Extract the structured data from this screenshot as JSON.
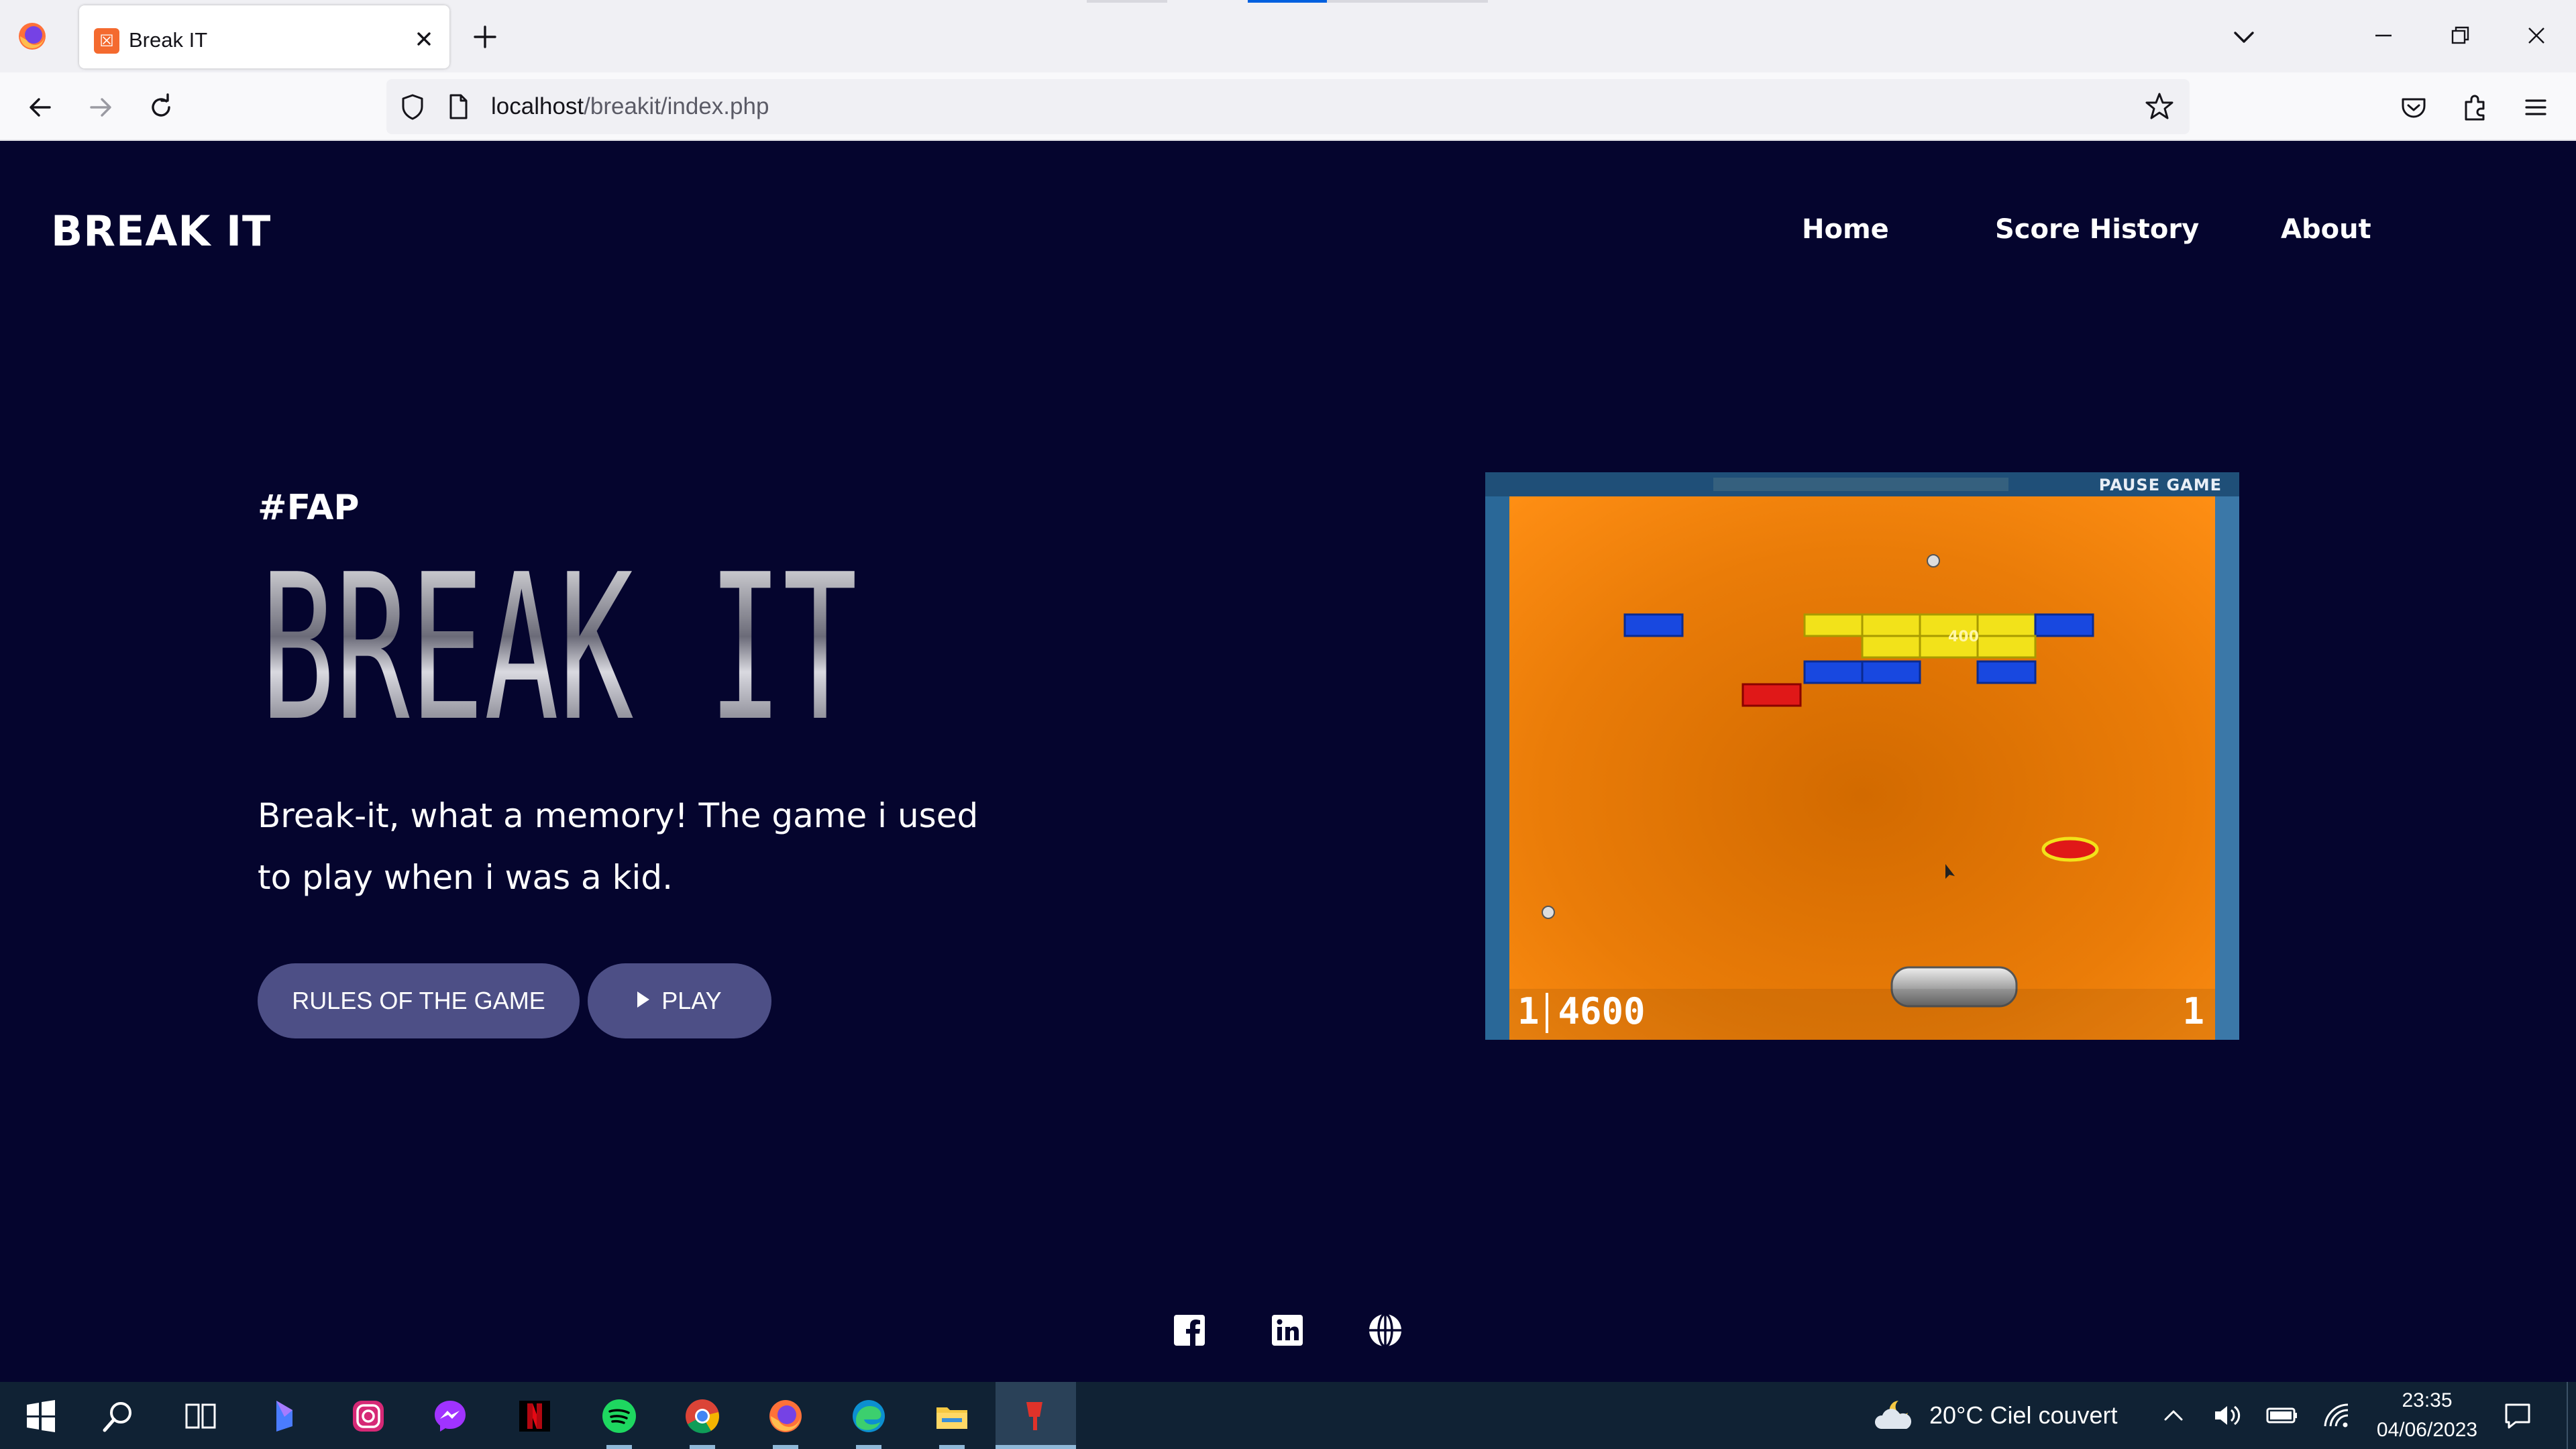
{
  "browser": {
    "tab_title": "Break IT",
    "tab_favicon": "☒",
    "url_host": "localhost",
    "url_path": "/breakit/index.php"
  },
  "site": {
    "logo": "BREAK IT",
    "nav": [
      "Home",
      "Score History",
      "About"
    ],
    "hashtag": "#FAP",
    "hero_title": "BREAK IT",
    "description": "Break-it, what a memory! The game i used to play when i was a kid.",
    "rules_button": "RULES OF THE GAME",
    "play_button": "PLAY"
  },
  "game": {
    "pause_label": "PAUSE GAME",
    "brick_label": "400",
    "lives": "1",
    "score": "4600",
    "stage": "1",
    "background_color": "#f08a10",
    "brick_colors": {
      "blue": "#1848e0",
      "yellow": "#f2e21a",
      "red": "#e01818"
    }
  },
  "footer": {
    "icons": [
      "facebook-icon",
      "linkedin-icon",
      "globe-icon"
    ]
  },
  "taskbar": {
    "weather": "20°C  Ciel couvert",
    "time": "23:35",
    "date": "04/06/2023",
    "apps": [
      "windows-start-icon",
      "search-icon",
      "task-view-icon",
      "bing-icon",
      "instagram-icon",
      "messenger-icon",
      "netflix-icon",
      "spotify-icon",
      "chrome-icon",
      "firefox-icon",
      "edge-icon",
      "file-explorer-icon",
      "active-app-icon"
    ]
  },
  "colors": {
    "page_background": "#05052e",
    "button_background": "#4d4f86",
    "accent_blue": "#0060df"
  }
}
